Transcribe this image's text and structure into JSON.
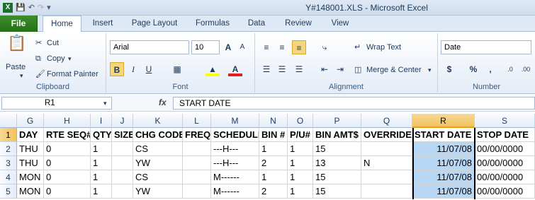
{
  "window": {
    "title": "Y#148001.XLS - Microsoft Excel"
  },
  "quick_access": {
    "save_icon": "save-icon",
    "undo_icon": "undo-icon",
    "redo_icon": "redo-icon",
    "customize_icon": "chevron-down-icon"
  },
  "tabs": [
    "File",
    "Home",
    "Insert",
    "Page Layout",
    "Formulas",
    "Data",
    "Review",
    "View"
  ],
  "active_tab": "Home",
  "ribbon": {
    "clipboard": {
      "paste": "Paste",
      "cut": "Cut",
      "copy": "Copy",
      "format_painter": "Format Painter",
      "label": "Clipboard"
    },
    "font": {
      "font_name": "Arial",
      "font_size": "10",
      "grow": "A",
      "shrink": "A",
      "bold": "B",
      "italic": "I",
      "underline": "U",
      "font_color_letter": "A",
      "label": "Font"
    },
    "alignment": {
      "wrap_text": "Wrap Text",
      "merge_center": "Merge & Center",
      "label": "Alignment"
    },
    "number": {
      "format": "Date",
      "currency": "$",
      "percent": "%",
      "comma": ",",
      "label": "Number"
    }
  },
  "formula_bar": {
    "name_box": "R1",
    "fx": "fx",
    "content": "START DATE"
  },
  "grid": {
    "columns": [
      "G",
      "H",
      "I",
      "J",
      "K",
      "L",
      "M",
      "N",
      "O",
      "P",
      "Q",
      "R",
      "S"
    ],
    "selected_column": "R",
    "rows": [
      "1",
      "2",
      "3",
      "4",
      "5"
    ],
    "selected_row": "1",
    "cells": [
      [
        "DAY",
        "RTE SEQ#",
        "QTY",
        "SIZE",
        "CHG CODE",
        "FREQ",
        "SCHEDULE",
        "BIN #",
        "P/U#",
        "BIN AMT$",
        "OVERRIDE",
        "START DATE",
        "STOP DATE"
      ],
      [
        "THU",
        "0",
        "1",
        "",
        "CS",
        "",
        "---H---",
        "1",
        "1",
        "15",
        "",
        "11/07/08",
        "00/00/0000"
      ],
      [
        "THU",
        "0",
        "1",
        "",
        "YW",
        "",
        "---H---",
        "2",
        "1",
        "13",
        "N",
        "11/07/08",
        "00/00/0000"
      ],
      [
        "MON",
        "0",
        "1",
        "",
        "CS",
        "",
        "M------",
        "1",
        "1",
        "15",
        "",
        "11/07/08",
        "00/00/0000"
      ],
      [
        "MON",
        "0",
        "1",
        "",
        "YW",
        "",
        "M------",
        "2",
        "1",
        "15",
        "",
        "11/07/08",
        "00/00/0000"
      ]
    ]
  }
}
